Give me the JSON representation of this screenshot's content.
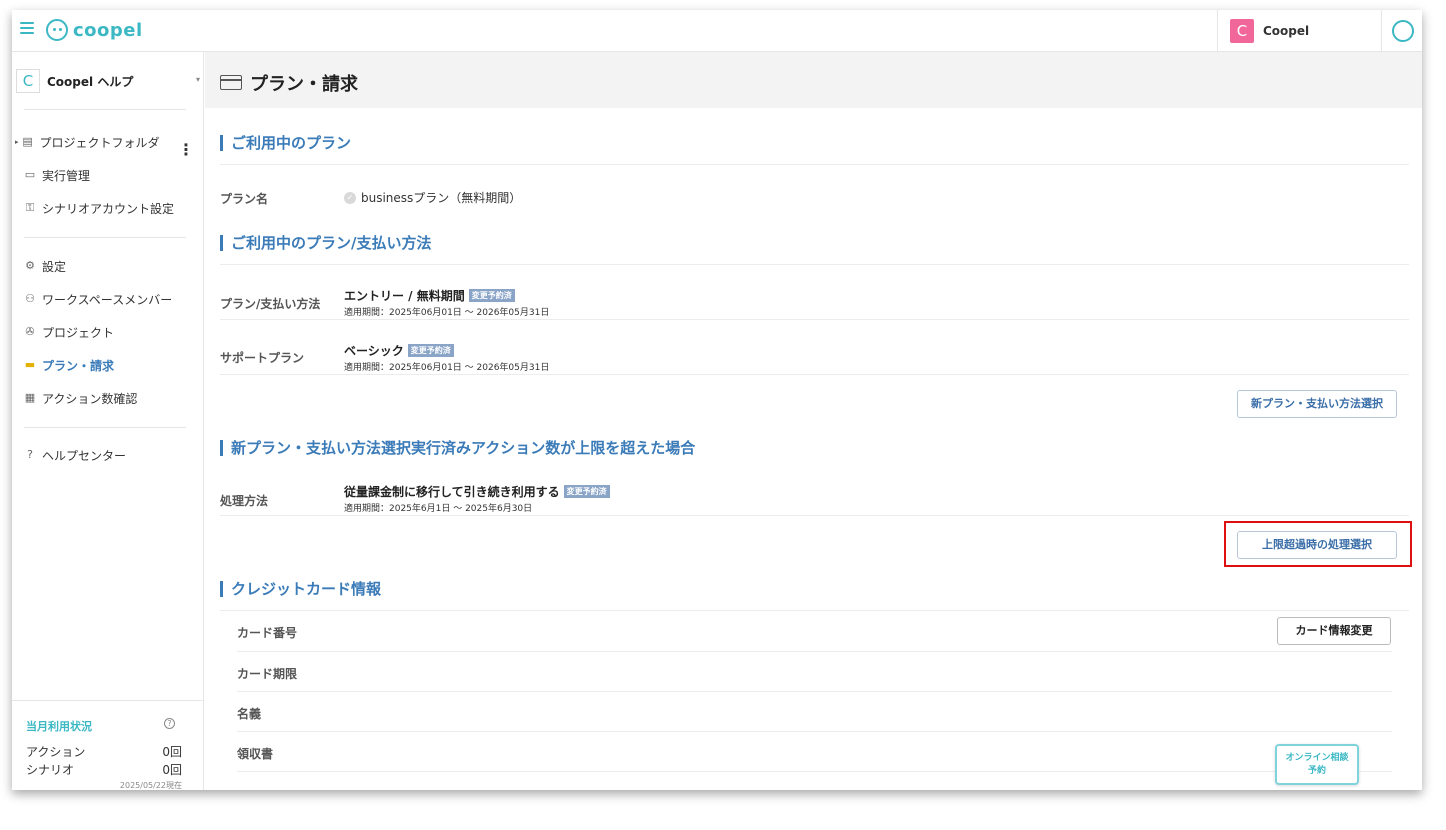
{
  "topbar": {
    "logo_text": "coopel",
    "workspace_initial": "C",
    "workspace_name": "Coopel"
  },
  "sidebar": {
    "workspace_initial": "C",
    "workspace_title": "Coopel ヘルプ",
    "items": [
      {
        "label": "プロジェクトフォルダ",
        "icon": "folder-icon"
      },
      {
        "label": "実行管理",
        "icon": "window-icon"
      },
      {
        "label": "シナリオアカウント設定",
        "icon": "account-lock-icon"
      },
      {
        "label": "設定",
        "icon": "gear-icon"
      },
      {
        "label": "ワークスペースメンバー",
        "icon": "people-icon"
      },
      {
        "label": "プロジェクト",
        "icon": "project-icon"
      },
      {
        "label": "プラン・請求",
        "icon": "card-icon",
        "active": true
      },
      {
        "label": "アクション数確認",
        "icon": "calendar-icon"
      },
      {
        "label": "ヘルプセンター",
        "icon": "help-icon"
      }
    ],
    "usage": {
      "title": "当月利用状況",
      "rows": [
        {
          "label": "アクション",
          "value": "0回"
        },
        {
          "label": "シナリオ",
          "value": "0回"
        }
      ],
      "as_of": "2025/05/22現在"
    }
  },
  "main": {
    "page_title": "プラン・請求",
    "current_plan": {
      "title": "ご利用中のプラン",
      "label": "プラン名",
      "value": "businessプラン（無料期間）"
    },
    "payment": {
      "title": "ご利用中のプラン/支払い方法",
      "rows": [
        {
          "label": "プラン/支払い方法",
          "value": "エントリー / 無料期間",
          "tag": "変更予約済",
          "period": "適用期間：2025年06月01日 〜 2026年05月31日"
        },
        {
          "label": "サポートプラン",
          "value": "ベーシック",
          "tag": "変更予約済",
          "period": "適用期間：2025年06月01日 〜 2026年05月31日"
        }
      ],
      "button": "新プラン・支払い方法選択"
    },
    "overage": {
      "title": "新プラン・支払い方法選択実行済みアクション数が上限を超えた場合",
      "label": "処理方法",
      "value": "従量課金制に移行して引き続き利用する",
      "tag": "変更予約済",
      "period": "適用期間：2025年6月1日 〜 2025年6月30日",
      "button": "上限超過時の処理選択"
    },
    "credit_card": {
      "title": "クレジットカード情報",
      "rows": [
        "カード番号",
        "カード期限",
        "名義",
        "領収書"
      ],
      "button": "カード情報変更"
    },
    "consult_button": "オンライン相談\n予約"
  },
  "colors": {
    "accent": "#3bb8c4",
    "section_blue": "#3a7bb8",
    "tag_bg": "#8aa4c8",
    "highlight": "#e01010",
    "avatar": "#f2679a"
  }
}
